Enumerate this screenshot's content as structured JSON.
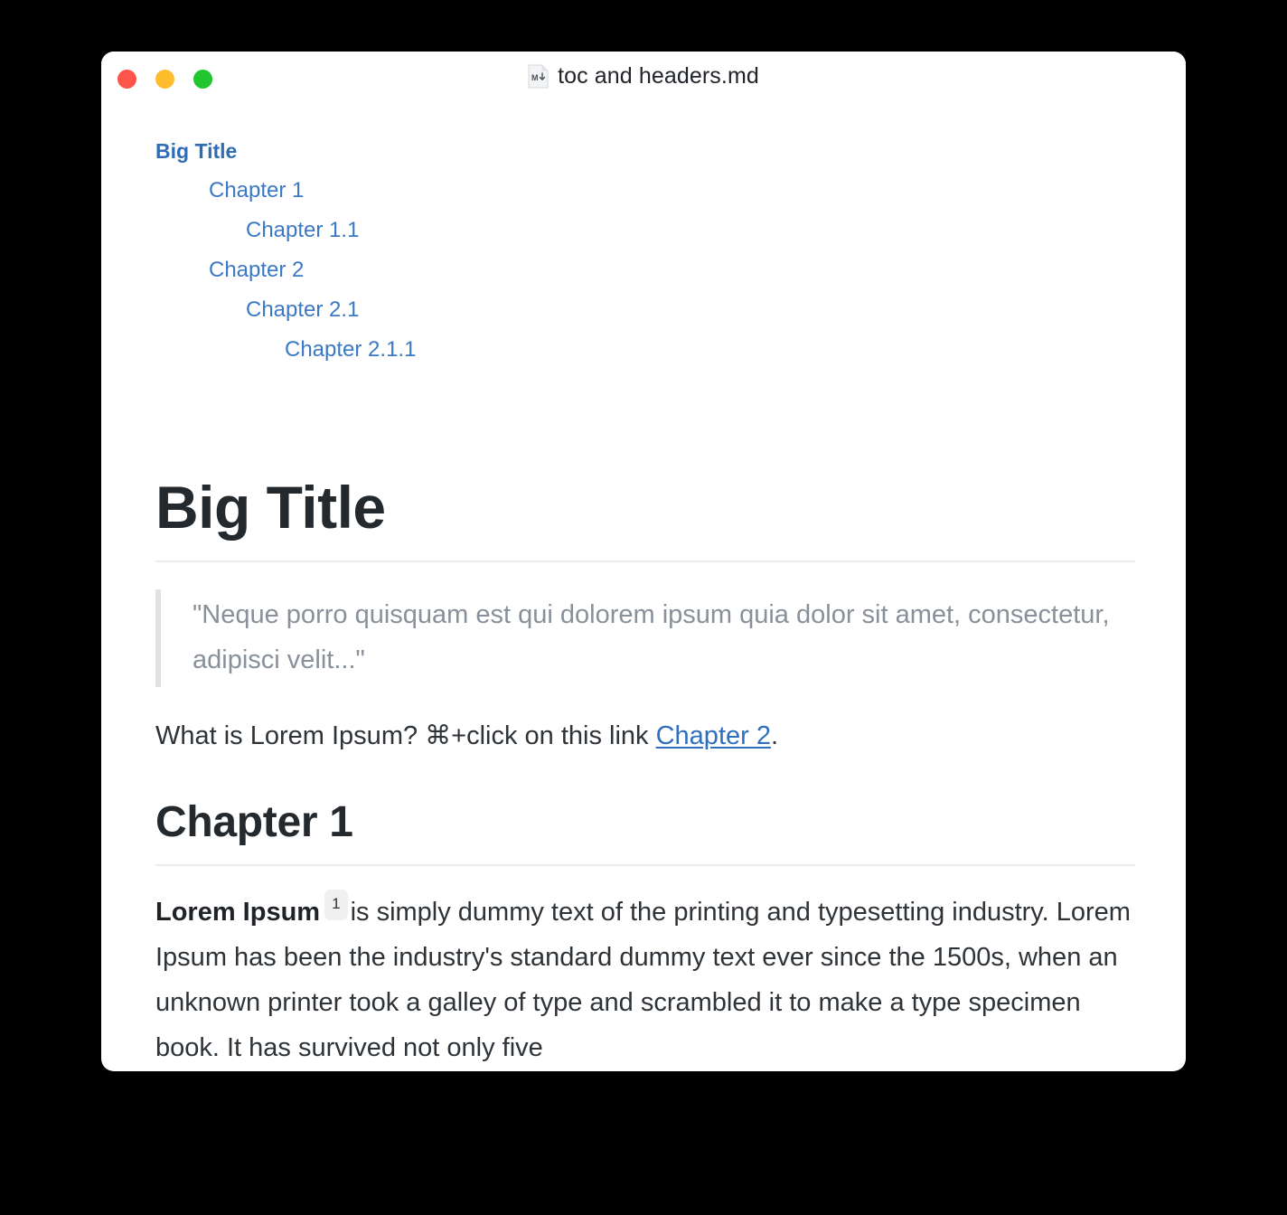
{
  "window": {
    "title": "toc and headers.md",
    "file_icon": "markdown-file-icon",
    "traffic_lights": {
      "close_label": "Close",
      "minimize_label": "Minimize",
      "maximize_label": "Maximize",
      "close_color": "#ff544a",
      "minimize_color": "#ffbc2d",
      "maximize_color": "#21c52f"
    },
    "background": "#ffffff"
  },
  "colors": {
    "desktop": "#000000",
    "link": "#2f6fc0",
    "toc_link": "#3b79c4",
    "toc_title_link": "#2e6db4",
    "heading": "#24292e",
    "body_text": "#2e3338",
    "blockquote_text": "#88909a",
    "blockquote_bar": "#dfe2e5",
    "rule": "#eaecef",
    "footnote_bg": "#f0f0f0"
  },
  "toc": [
    {
      "label": "Big Title",
      "level": 0
    },
    {
      "label": "Chapter 1",
      "level": 1
    },
    {
      "label": "Chapter 1.1",
      "level": 2
    },
    {
      "label": "Chapter 2",
      "level": 1
    },
    {
      "label": "Chapter 2.1",
      "level": 2
    },
    {
      "label": "Chapter 2.1.1",
      "level": 3
    }
  ],
  "content": {
    "h1": "Big Title",
    "blockquote": "\"Neque porro quisquam est qui dolorem ipsum quia dolor sit amet, consectetur, adipisci velit...\"",
    "link_paragraph": {
      "before": "What is Lorem Ipsum? ⌘+click on this link ",
      "link_text": "Chapter 2",
      "after": "."
    },
    "h2": "Chapter 1",
    "body_paragraph": {
      "bold_lead": "Lorem Ipsum",
      "footnote_marker": "1",
      "rest": "is simply dummy text of the printing and typesetting industry. Lorem Ipsum has been the industry's standard dummy text ever since the 1500s, when an unknown printer took a galley of type and scrambled it to make a type specimen book. It has survived not only five"
    }
  }
}
